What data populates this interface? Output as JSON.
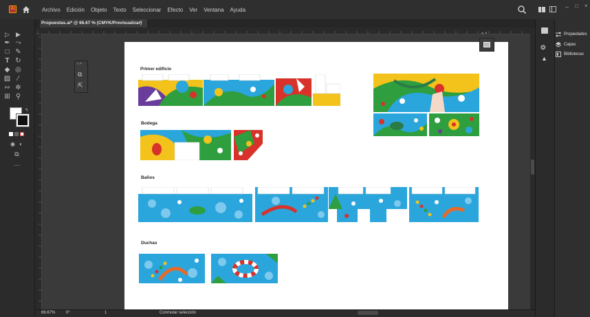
{
  "app": {
    "logo_text": "Ai",
    "menu": [
      "Archivo",
      "Edición",
      "Objeto",
      "Texto",
      "Seleccionar",
      "Efecto",
      "Ver",
      "Ventana",
      "Ayuda"
    ]
  },
  "document": {
    "tab_title": "Propuestas.ai* @ 66.67 % (CMYK/Previsualizar)",
    "tab_close": "×"
  },
  "artboard": {
    "sections": [
      {
        "label": "Primer edificio"
      },
      {
        "label": "Bodega"
      },
      {
        "label": "Baños"
      },
      {
        "label": "Duchas"
      }
    ]
  },
  "right_panel": {
    "items": [
      {
        "label": "Propiedades",
        "icon": "sliders-icon"
      },
      {
        "label": "Capas",
        "icon": "layers-icon"
      },
      {
        "label": "Bibliotecas",
        "icon": "library-icon"
      }
    ]
  },
  "status": {
    "zoom": "66.67%",
    "angle": "0°",
    "artboard_number": "1",
    "toggle_selection": "Conmutar selección"
  },
  "colors": {
    "accent": "#ff9a00",
    "chrome_dark": "#2f2f2f",
    "canvas": "#3a3a3a",
    "art_blue": "#2aa6dc",
    "art_green": "#2f9e3f",
    "art_yellow": "#f3c21b",
    "art_red": "#d8322a",
    "art_purple": "#6a3c9c"
  }
}
